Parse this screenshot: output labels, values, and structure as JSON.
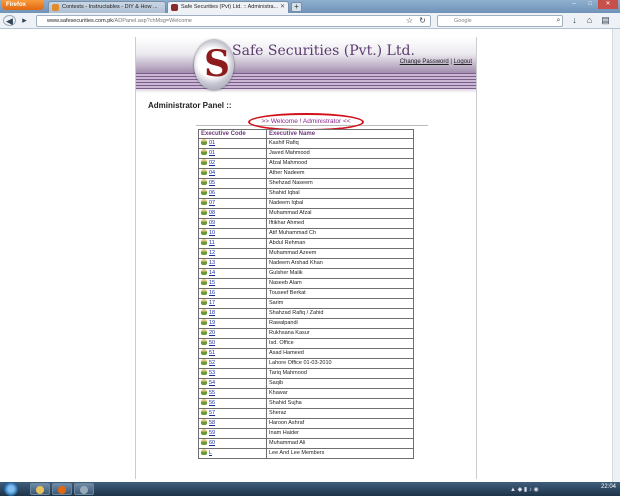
{
  "browser": {
    "app_button": "Firefox",
    "tabs": [
      {
        "label": "Contests - Instructables - DIY & How ..."
      },
      {
        "label": "Safe Securities (Pvt) Ltd. :: Administra..."
      }
    ],
    "new_tab": "+",
    "url_host": "www.safesecurities.com.pk",
    "url_path": "/ADPanel.asp?chMsg=Welcome",
    "search_placeholder": "Google"
  },
  "site": {
    "company_name": "Safe Securities (Pvt.) Ltd.",
    "logo_letter": "S",
    "links": {
      "change_password": "Change Password",
      "separator": "|",
      "logout": "Logout"
    },
    "panel_title": "Administrator Panel ::",
    "welcome": ">> Welcome ! Administrator <<"
  },
  "table": {
    "headers": [
      "Executive Code",
      "Executive Name"
    ],
    "rows": [
      [
        "01",
        "Kashif Rafiq"
      ],
      [
        "01",
        "Javed Mahmood"
      ],
      [
        "02",
        "Afzal Mahmood"
      ],
      [
        "04",
        "Ather Nadeem"
      ],
      [
        "05",
        "Shehzad Naseem"
      ],
      [
        "06",
        "Shahid Iqbal"
      ],
      [
        "07",
        "Nadeem Iqbal"
      ],
      [
        "08",
        "Muhammad Afzal"
      ],
      [
        "09",
        "Iftikhar Ahmed"
      ],
      [
        "10",
        "Atif Muhammad Ch"
      ],
      [
        "11",
        "Abdul Rehman"
      ],
      [
        "12",
        "Muhammad Azeem"
      ],
      [
        "13",
        "Nadeem Arshad Khan"
      ],
      [
        "14",
        "Gulsher Malik"
      ],
      [
        "15",
        "Naseeb Alam"
      ],
      [
        "16",
        "Touseef Berkat"
      ],
      [
        "17",
        "Sarim"
      ],
      [
        "18",
        "Shahzad Rafiq / Zahid"
      ],
      [
        "19",
        "Rawalpandi"
      ],
      [
        "20",
        "Rukhsana Kasur"
      ],
      [
        "50",
        "Isd. Office"
      ],
      [
        "51",
        "Asad Hameed"
      ],
      [
        "52",
        "Lahore Office 01-03-2010"
      ],
      [
        "53",
        "Tariq Mahmood"
      ],
      [
        "54",
        "Saqib"
      ],
      [
        "55",
        "Khawar"
      ],
      [
        "56",
        "Shahid Sujha"
      ],
      [
        "57",
        "Sheraz"
      ],
      [
        "58",
        "Haroon Ashraf"
      ],
      [
        "59",
        "Inam Haider"
      ],
      [
        "60",
        "Muhammad Ali"
      ],
      [
        "L",
        "Lee And Lee Members"
      ]
    ]
  },
  "taskbar": {
    "clock": "22:04"
  },
  "colors": {
    "accent_purple": "#5b3c6e",
    "welcome_circle": "#d1101c"
  }
}
